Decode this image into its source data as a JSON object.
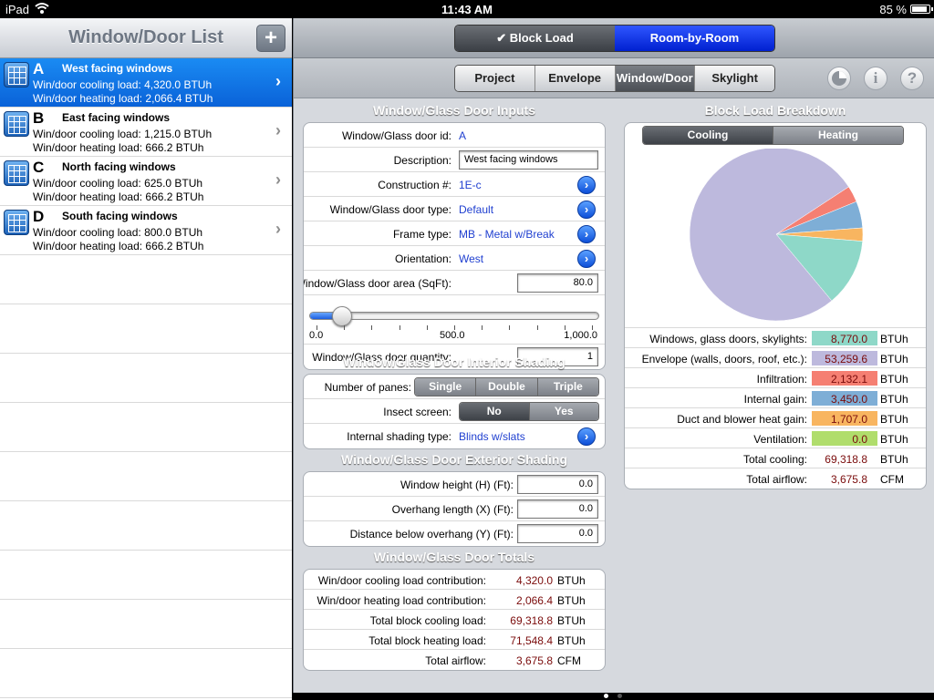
{
  "status": {
    "device": "iPad",
    "time": "11:43 AM",
    "battery": "85 %"
  },
  "left": {
    "title": "Window/Door List",
    "add_label": "+",
    "items": [
      {
        "letter": "A",
        "name": "West facing windows",
        "cooling": "Win/door cooling load: 4,320.0 BTUh",
        "heating": "Win/door heating load: 2,066.4 BTUh"
      },
      {
        "letter": "B",
        "name": "East facing windows",
        "cooling": "Win/door cooling load: 1,215.0 BTUh",
        "heating": "Win/door heating load: 666.2 BTUh"
      },
      {
        "letter": "C",
        "name": "North facing windows",
        "cooling": "Win/door cooling load: 625.0 BTUh",
        "heating": "Win/door heating load: 666.2 BTUh"
      },
      {
        "letter": "D",
        "name": "South facing windows",
        "cooling": "Win/door cooling load: 800.0 BTUh",
        "heating": "Win/door heating load: 666.2 BTUh"
      }
    ]
  },
  "toolbar": {
    "mode_block": "✔ Block Load",
    "mode_room": "Room-by-Room"
  },
  "nav": {
    "project": "Project",
    "envelope": "Envelope",
    "windowdoor": "Window/Door",
    "skylight": "Skylight"
  },
  "inputs": {
    "title": "Window/Glass Door Inputs",
    "id_label": "Window/Glass door id:",
    "id_value": "A",
    "desc_label": "Description:",
    "desc_value": "West facing windows",
    "constr_label": "Construction #:",
    "constr_value": "1E-c",
    "type_label": "Window/Glass door type:",
    "type_value": "Default",
    "frame_label": "Frame type:",
    "frame_value": "MB - Metal w/Break",
    "orient_label": "Orientation:",
    "orient_value": "West",
    "area_label": "Window/Glass door area (SqFt):",
    "area_value": "80.0",
    "slider_min": "0.0",
    "slider_mid": "500.0",
    "slider_max": "1,000.0",
    "slider_fraction": 0.08,
    "qty_label": "Window/Glass door quantity:",
    "qty_value": "1"
  },
  "interior": {
    "title": "Window/Glass Door Interior Shading",
    "panes_label": "Number of panes:",
    "single": "Single",
    "double": "Double",
    "triple": "Triple",
    "screen_label": "Insect screen:",
    "no": "No",
    "yes": "Yes",
    "shading_label": "Internal shading type:",
    "shading_value": "Blinds w/slats"
  },
  "exterior": {
    "title": "Window/Glass Door Exterior Shading",
    "height_label": "Window height (H) (Ft):",
    "height_value": "0.0",
    "overhang_label": "Overhang length (X) (Ft):",
    "overhang_value": "0.0",
    "below_label": "Distance below overhang (Y) (Ft):",
    "below_value": "0.0"
  },
  "totals": {
    "title": "Window/Glass Door Totals",
    "rows": [
      {
        "label": "Win/door cooling load contribution:",
        "value": "4,320.0",
        "unit": "BTUh"
      },
      {
        "label": "Win/door heating load contribution:",
        "value": "2,066.4",
        "unit": "BTUh"
      },
      {
        "label": "Total block cooling load:",
        "value": "69,318.8",
        "unit": "BTUh"
      },
      {
        "label": "Total block heating load:",
        "value": "71,548.4",
        "unit": "BTUh"
      },
      {
        "label": "Total airflow:",
        "value": "3,675.8",
        "unit": "CFM"
      }
    ]
  },
  "breakdown": {
    "title": "Block Load Breakdown",
    "cooling_tab": "Cooling",
    "heating_tab": "Heating",
    "rows": [
      {
        "label": "Windows, glass doors, skylights:",
        "value": "8,770.0",
        "unit": "BTUh",
        "color": "#8ed8c8"
      },
      {
        "label": "Envelope (walls, doors, roof, etc.):",
        "value": "53,259.6",
        "unit": "BTUh",
        "color": "#bdb9dd"
      },
      {
        "label": "Infiltration:",
        "value": "2,132.1",
        "unit": "BTUh",
        "color": "#f57f72"
      },
      {
        "label": "Internal gain:",
        "value": "3,450.0",
        "unit": "BTUh",
        "color": "#7eaed6"
      },
      {
        "label": "Duct and blower heat gain:",
        "value": "1,707.0",
        "unit": "BTUh",
        "color": "#f8b560"
      },
      {
        "label": "Ventilation:",
        "value": "0.0",
        "unit": "BTUh",
        "color": "#b0dd6c"
      },
      {
        "label": "Total cooling:",
        "value": "69,318.8",
        "unit": "BTUh"
      },
      {
        "label": "Total airflow:",
        "value": "3,675.8",
        "unit": "CFM"
      }
    ]
  },
  "pie_data": {
    "type": "pie",
    "values": [
      8770.0,
      53259.6,
      2132.1,
      3450.0,
      1707.0,
      0.0
    ],
    "colors": [
      "#8ed8c8",
      "#bdb9dd",
      "#f57f72",
      "#7eaed6",
      "#f8b560",
      "#b0dd6c"
    ]
  }
}
